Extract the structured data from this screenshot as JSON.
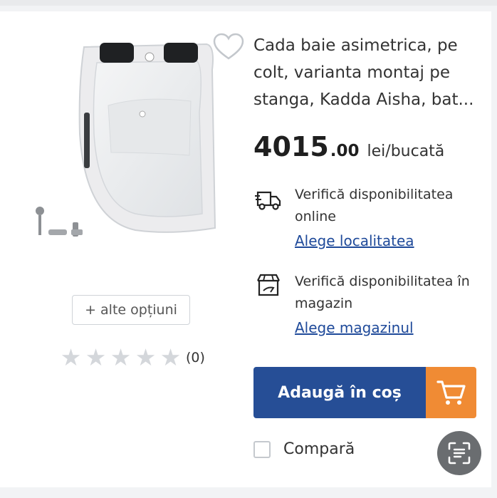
{
  "product": {
    "title": "Cada baie asimetrica, pe colt, varianta montaj pe stanga, Kadda Aisha, bat...",
    "price_integer": "4015",
    "price_decimal": ".00",
    "price_unit": "lei/bucată",
    "image_icon": "asymmetric-bathtub-image"
  },
  "availability": {
    "online_text": "Verifică disponibilitatea online",
    "online_link": "Alege localitatea",
    "store_text": "Verifică disponibilitatea în magazin",
    "store_link": "Alege magazinul"
  },
  "options_button": "+ alte opțiuni",
  "rating": {
    "stars_filled": 0,
    "stars_total": 5,
    "count": "(0)"
  },
  "cart_button": "Adaugă în coș",
  "compare_label": "Compară",
  "colors": {
    "primary": "#264e96",
    "accent": "#f08b34",
    "link": "#1f4a9a"
  },
  "icons": [
    "heart-outline-icon",
    "delivery-truck-icon",
    "store-pickup-icon",
    "star-icon",
    "shopping-cart-icon",
    "scan-text-icon"
  ]
}
